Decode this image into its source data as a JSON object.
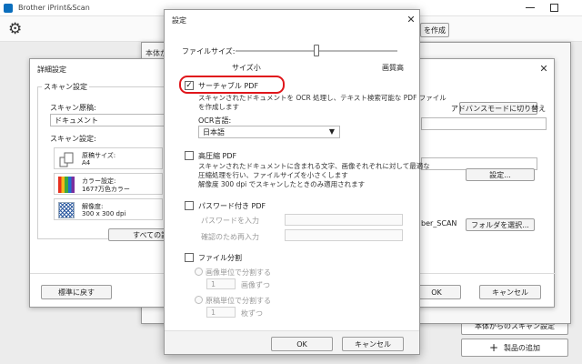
{
  "app": {
    "title": "Brother iPrint&Scan",
    "create_button_fragment": "を作成",
    "scan_from_device_button": "本体からのスキャン設定",
    "add_device_button": "製品の追加"
  },
  "device_settings_window": {
    "title_fragment": "本体か"
  },
  "detail_settings": {
    "title": "詳細設定",
    "scan_settings_group": "スキャン設定",
    "scan_document_label": "スキャン原稿:",
    "scan_document_value": "ドキュメント",
    "scan_settings_label": "スキャン設定:",
    "items": [
      {
        "label": "原稿サイズ:",
        "value": "A4",
        "icon": "document-size-icon"
      },
      {
        "label": "カラー設定:",
        "value": "1677万色カラー",
        "icon": "color-setting-icon"
      },
      {
        "label": "解像度:",
        "value": "300 x 300 dpi",
        "icon": "resolution-icon"
      }
    ],
    "all_settings_fragment": "すべての設定",
    "advanced_mode_button": "アドバンスモードに切り替え",
    "settings_button": "設定...",
    "folder_path_fragment": "ber_SCAN",
    "select_folder_button": "フォルダを選択...",
    "reset_button": "標準に戻す",
    "ok_button": "OK",
    "cancel_button": "キャンセル"
  },
  "settings_dialog": {
    "title": "設定",
    "file_size_label": "ファイルサイズ:",
    "file_size_level": 0.5,
    "size_small_label": "サイズ小",
    "quality_high_label": "画質高",
    "searchable_pdf": {
      "label": "サーチャブル PDF",
      "checked": true,
      "description": [
        "スキャンされたドキュメントを OCR 処理し、テキスト検索可能な PDF ファイル",
        "を作成します"
      ],
      "ocr_language_label": "OCR言語:",
      "ocr_language_value": "日本語"
    },
    "high_compression_pdf": {
      "label": "高圧縮 PDF",
      "checked": false,
      "description": [
        "スキャンされたドキュメントに含まれる文字、画像それぞれに対して最適な",
        "圧縮処理を行い、ファイルサイズを小さくします",
        "解像度 300 dpi でスキャンしたときのみ適用されます"
      ]
    },
    "password_pdf": {
      "label": "パスワード付き PDF",
      "checked": false,
      "password_placeholder": "パスワードを入力",
      "confirm_placeholder": "確認のため再入力"
    },
    "file_split": {
      "label": "ファイル分割",
      "checked": false,
      "by_page_label": "画像単位で分割する",
      "page_count": "1",
      "page_unit": "画像ずつ",
      "by_document_label": "原稿単位で分割する",
      "doc_count": "1",
      "doc_unit": "枚ずつ"
    },
    "ok_button": "OK",
    "cancel_button": "キャンセル"
  },
  "colors": {
    "highlight": "#e0161b",
    "accent": "#0a6ebd"
  }
}
